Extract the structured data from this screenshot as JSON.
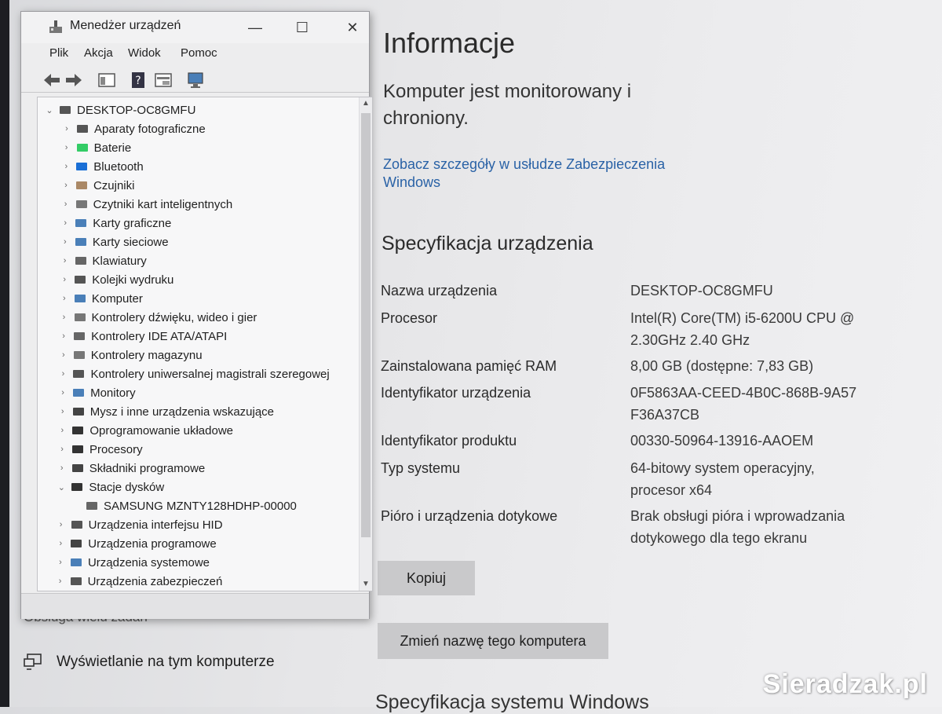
{
  "device_manager": {
    "title": "Menedżer urządzeń",
    "menu": [
      "Plik",
      "Akcja",
      "Widok",
      "Pomoc"
    ],
    "window_controls": {
      "minimize": "—",
      "maximize": "☐",
      "close": "✕"
    },
    "tree": {
      "root": "DESKTOP-OC8GMFU",
      "items": [
        {
          "label": "Aparaty fotograficzne",
          "icon": "camera-icon"
        },
        {
          "label": "Baterie",
          "icon": "battery-icon"
        },
        {
          "label": "Bluetooth",
          "icon": "bluetooth-icon"
        },
        {
          "label": "Czujniki",
          "icon": "sensor-icon"
        },
        {
          "label": "Czytniki kart inteligentnych",
          "icon": "smartcard-reader-icon"
        },
        {
          "label": "Karty graficzne",
          "icon": "display-adapter-icon"
        },
        {
          "label": "Karty sieciowe",
          "icon": "network-adapter-icon"
        },
        {
          "label": "Klawiatury",
          "icon": "keyboard-icon"
        },
        {
          "label": "Kolejki wydruku",
          "icon": "printer-icon"
        },
        {
          "label": "Komputer",
          "icon": "computer-icon"
        },
        {
          "label": "Kontrolery dźwięku, wideo i gier",
          "icon": "speaker-icon"
        },
        {
          "label": "Kontrolery IDE ATA/ATAPI",
          "icon": "ide-controller-icon"
        },
        {
          "label": "Kontrolery magazynu",
          "icon": "storage-controller-icon"
        },
        {
          "label": "Kontrolery uniwersalnej magistrali szeregowej",
          "icon": "usb-icon"
        },
        {
          "label": "Monitory",
          "icon": "monitor-icon"
        },
        {
          "label": "Mysz i inne urządzenia wskazujące",
          "icon": "mouse-icon"
        },
        {
          "label": "Oprogramowanie układowe",
          "icon": "firmware-icon"
        },
        {
          "label": "Procesory",
          "icon": "processor-icon"
        },
        {
          "label": "Składniki programowe",
          "icon": "software-component-icon"
        },
        {
          "label": "Stacje dysków",
          "icon": "disk-drive-icon",
          "expanded": true
        },
        {
          "label": "SAMSUNG MZNTY128HDHP-00000",
          "icon": "drive-icon",
          "child": true
        },
        {
          "label": "Urządzenia interfejsu HID",
          "icon": "hid-icon"
        },
        {
          "label": "Urządzenia programowe",
          "icon": "software-device-icon"
        },
        {
          "label": "Urządzenia systemowe",
          "icon": "system-device-icon"
        },
        {
          "label": "Urządzenia zabezpieczeń",
          "icon": "security-device-icon"
        }
      ]
    }
  },
  "settings": {
    "info_title": "Informacje",
    "protected_text": "Komputer jest monitorowany i chroniony.",
    "security_link": "Zobacz szczegóły w usłudze Zabezpieczenia Windows",
    "spec_title": "Specyfikacja urządzenia",
    "specs": [
      {
        "label": "Nazwa urządzenia",
        "value": "DESKTOP-OC8GMFU"
      },
      {
        "label": "Procesor",
        "value": "Intel(R) Core(TM) i5-6200U CPU @ 2.30GHz   2.40 GHz"
      },
      {
        "label": "Zainstalowana pamięć RAM",
        "value": "8,00 GB (dostępne: 7,83 GB)"
      },
      {
        "label": "Identyfikator urządzenia",
        "value": "0F5863AA-CEED-4B0C-868B-9A57F36A37CB"
      },
      {
        "label": "Identyfikator produktu",
        "value": "00330-50964-13916-AAOEM"
      },
      {
        "label": "Typ systemu",
        "value": "64-bitowy system operacyjny, procesor x64"
      },
      {
        "label": "Pióro i urządzenia dotykowe",
        "value": "Brak obsługi pióra i wprowadzania dotykowego dla tego ekranu"
      }
    ],
    "copy_button": "Kopiuj",
    "rename_button": "Zmień nazwę tego komputera",
    "windows_spec_title": "Specyfikacja systemu Windows",
    "sidebar": {
      "partially_hidden_item": "Obsługa wielu zadań",
      "display_item": "Wyświetlanie na tym komputerze"
    }
  },
  "watermark": "Sieradzak.pl",
  "colors": {
    "link": "#2a62a6",
    "button": "#c9c9cb"
  }
}
